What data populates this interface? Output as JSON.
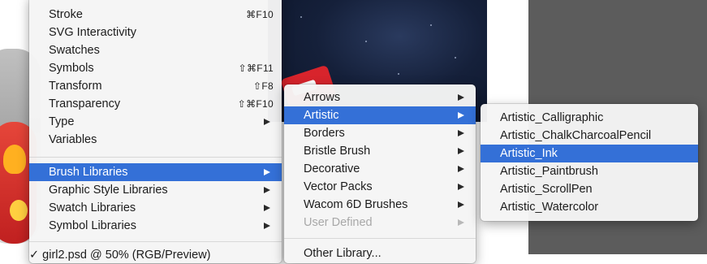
{
  "window_menu": {
    "items": [
      {
        "label": "Stroke",
        "shortcut": "⌘F10"
      },
      {
        "label": "SVG Interactivity",
        "shortcut": ""
      },
      {
        "label": "Swatches",
        "shortcut": ""
      },
      {
        "label": "Symbols",
        "shortcut": "⇧⌘F11"
      },
      {
        "label": "Transform",
        "shortcut": "⇧F8"
      },
      {
        "label": "Transparency",
        "shortcut": "⇧⌘F10"
      },
      {
        "label": "Type",
        "shortcut": ""
      },
      {
        "label": "Variables",
        "shortcut": ""
      }
    ],
    "libraries": [
      {
        "label": "Brush Libraries"
      },
      {
        "label": "Graphic Style Libraries"
      },
      {
        "label": "Swatch Libraries"
      },
      {
        "label": "Symbol Libraries"
      }
    ],
    "documents": [
      {
        "label": "✓ girl2.psd @ 50% (RGB/Preview)"
      }
    ]
  },
  "brush_libraries_menu": {
    "items": [
      {
        "label": "Arrows"
      },
      {
        "label": "Artistic"
      },
      {
        "label": "Borders"
      },
      {
        "label": "Bristle Brush"
      },
      {
        "label": "Decorative"
      },
      {
        "label": "Vector Packs"
      },
      {
        "label": "Wacom 6D Brushes"
      },
      {
        "label": "User Defined"
      }
    ],
    "other": {
      "label": "Other Library..."
    }
  },
  "artistic_menu": {
    "items": [
      {
        "label": "Artistic_Calligraphic"
      },
      {
        "label": "Artistic_ChalkCharcoalPencil"
      },
      {
        "label": "Artistic_Ink"
      },
      {
        "label": "Artistic_Paintbrush"
      },
      {
        "label": "Artistic_ScrollPen"
      },
      {
        "label": "Artistic_Watercolor"
      }
    ]
  },
  "colors": {
    "selection": "#3470d7",
    "menu_bg": "#f5f5f5",
    "workspace_gray": "#5c5c5c"
  },
  "state": {
    "selected_window_item": "Brush Libraries",
    "selected_brush_library": "Artistic",
    "highlighted_artistic": "Artistic_Ink"
  }
}
